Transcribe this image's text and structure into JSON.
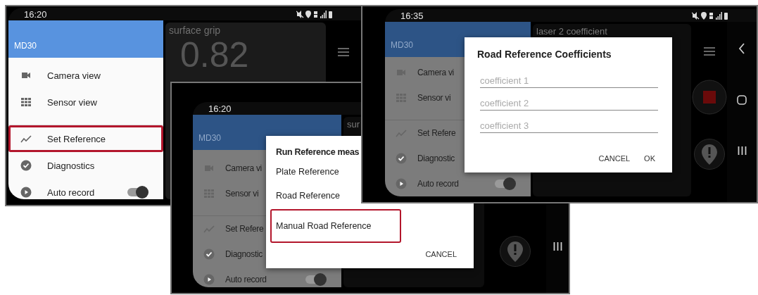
{
  "panels": [
    {
      "dimmed": false,
      "status": {
        "time": "16:20",
        "icons": true
      },
      "drawer": {
        "title": "MD30",
        "items": [
          {
            "label": "Camera view",
            "kind": "link",
            "highlighted": false
          },
          {
            "label": "Sensor view",
            "kind": "link",
            "highlighted": false
          },
          {
            "label": "Set Reference",
            "kind": "link",
            "highlighted": true
          },
          {
            "label": "Diagnostics",
            "kind": "link",
            "highlighted": false
          },
          {
            "label": "Auto record",
            "kind": "toggle",
            "on": true,
            "highlighted": false
          }
        ]
      },
      "card": {
        "title": "surface grip",
        "reading": "0.82"
      },
      "side_buttons": [
        {
          "kind": "menu"
        }
      ]
    },
    {
      "dimmed": true,
      "status": {
        "time": "16:20"
      },
      "drawer": {
        "title": "MD30",
        "items": [
          {
            "label": "Camera vi",
            "kind": "link"
          },
          {
            "label": "Sensor vi",
            "kind": "link"
          },
          {
            "label": "Set Refere",
            "kind": "link"
          },
          {
            "label": "Diagnostic",
            "kind": "link"
          },
          {
            "label": "Auto record",
            "kind": "toggle",
            "on": true
          }
        ]
      },
      "card": {
        "title": "sur"
      },
      "side_buttons": [
        {
          "kind": "alert"
        }
      ],
      "nav_buttons": [
        {
          "kind": "recents"
        }
      ],
      "dialog": {
        "kind": "choice",
        "title": "Run Reference meas",
        "options": [
          {
            "label": "Plate Reference",
            "highlighted": false
          },
          {
            "label": "Road Reference",
            "highlighted": false
          },
          {
            "label": "Manual Road Reference",
            "highlighted": true
          }
        ],
        "buttons": [
          "CANCEL"
        ]
      }
    },
    {
      "dimmed": true,
      "status": {
        "time": "16:35",
        "icons": true
      },
      "drawer": {
        "title": "MD30",
        "items": [
          {
            "label": "Camera vi",
            "kind": "link"
          },
          {
            "label": "Sensor vi",
            "kind": "link"
          },
          {
            "label": "Set Refere",
            "kind": "link"
          },
          {
            "label": "Diagnostic",
            "kind": "link"
          },
          {
            "label": "Auto record",
            "kind": "toggle",
            "on": true
          }
        ]
      },
      "card": {
        "title": "laser 2 coefficient"
      },
      "side_buttons": [
        {
          "kind": "menu"
        },
        {
          "kind": "record"
        },
        {
          "kind": "alert"
        }
      ],
      "nav_buttons": [
        {
          "kind": "back"
        },
        {
          "kind": "home"
        },
        {
          "kind": "recents"
        }
      ],
      "dialog": {
        "kind": "form",
        "title": "Road Reference Coefficients",
        "fields": [
          {
            "placeholder": "coefficient 1"
          },
          {
            "placeholder": "coefficient 2"
          },
          {
            "placeholder": "coefficient 3"
          }
        ],
        "buttons": [
          "CANCEL",
          "OK"
        ]
      }
    }
  ]
}
